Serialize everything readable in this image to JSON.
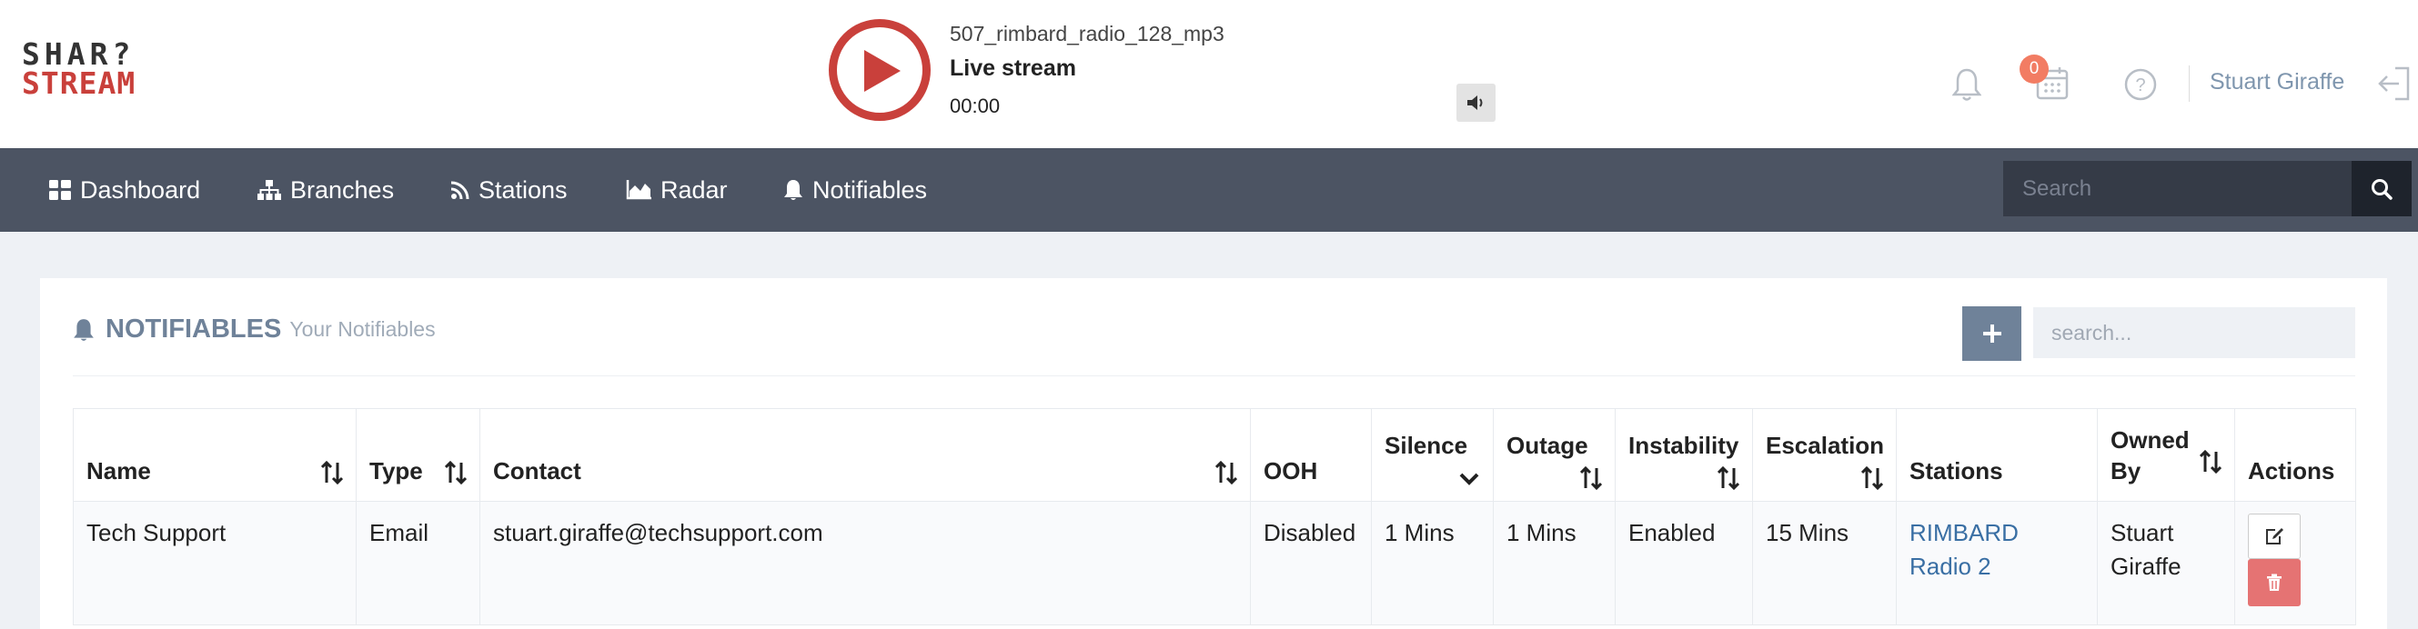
{
  "logo": {
    "line1": "SHAR?",
    "line2": "STREAM"
  },
  "player": {
    "track": "507_rimbard_radio_128_mp3",
    "stream_label": "Live stream",
    "time": "00:00"
  },
  "header": {
    "notification_badge": "0",
    "user_name": "Stuart Giraffe"
  },
  "nav": {
    "items": [
      {
        "label": "Dashboard",
        "icon": "dashboard-icon"
      },
      {
        "label": "Branches",
        "icon": "sitemap-icon"
      },
      {
        "label": "Stations",
        "icon": "rss-icon"
      },
      {
        "label": "Radar",
        "icon": "area-chart-icon"
      },
      {
        "label": "Notifiables",
        "icon": "bell-icon"
      }
    ],
    "search_placeholder": "Search"
  },
  "panel": {
    "title": "NOTIFIABLES",
    "subtitle": "Your Notifiables",
    "search_placeholder": "search..."
  },
  "table": {
    "headers": [
      "Name",
      "Type",
      "Contact",
      "OOH",
      "Silence",
      "Outage",
      "Instability",
      "Escalation",
      "Stations",
      "Owned By",
      "Actions"
    ],
    "rows": [
      {
        "name": "Tech Support",
        "type": "Email",
        "contact": "stuart.giraffe@techsupport.com",
        "ooh": "Disabled",
        "silence": "1 Mins",
        "outage": "1 Mins",
        "instability": "Enabled",
        "escalation": "15 Mins",
        "stations": "RIMBARD Radio 2",
        "owned_by": "Stuart Giraffe"
      }
    ]
  },
  "colors": {
    "brand_red": "#c9403b",
    "nav_bg": "#4c5463",
    "accent": "#6f8299",
    "link": "#3a6fa4",
    "danger": "#e57373"
  }
}
